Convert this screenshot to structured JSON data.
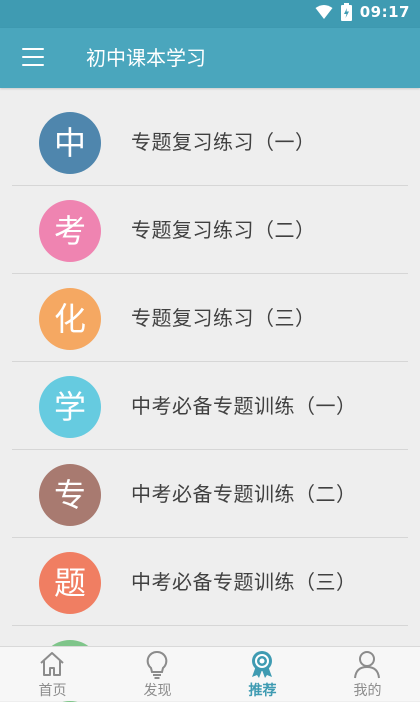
{
  "status_bar": {
    "time": "09:17",
    "icons": [
      "wifi-icon",
      "battery-icon"
    ]
  },
  "app_bar": {
    "title": "初中课本学习",
    "menu_icon": "hamburger-menu-icon"
  },
  "list": {
    "items": [
      {
        "badge": "中",
        "label": "专题复习练习（一）",
        "color": "#4f86ad"
      },
      {
        "badge": "考",
        "label": "专题复习练习（二）",
        "color": "#ef84b1"
      },
      {
        "badge": "化",
        "label": "专题复习练习（三）",
        "color": "#f5a862"
      },
      {
        "badge": "学",
        "label": "中考必备专题训练（一）",
        "color": "#66cbe0"
      },
      {
        "badge": "专",
        "label": "中考必备专题训练（二）",
        "color": "#a87a70"
      },
      {
        "badge": "题",
        "label": "中考必备专题训练（三）",
        "color": "#f07e62"
      }
    ]
  },
  "bottom_nav": {
    "tabs": [
      {
        "label": "首页",
        "icon": "home-icon",
        "active": false
      },
      {
        "label": "发现",
        "icon": "lightbulb-icon",
        "active": false
      },
      {
        "label": "推荐",
        "icon": "award-badge-icon",
        "active": true
      },
      {
        "label": "我的",
        "icon": "person-icon",
        "active": false
      }
    ],
    "active_color": "#3f9bb2",
    "inactive_color": "#8c8c8c"
  }
}
